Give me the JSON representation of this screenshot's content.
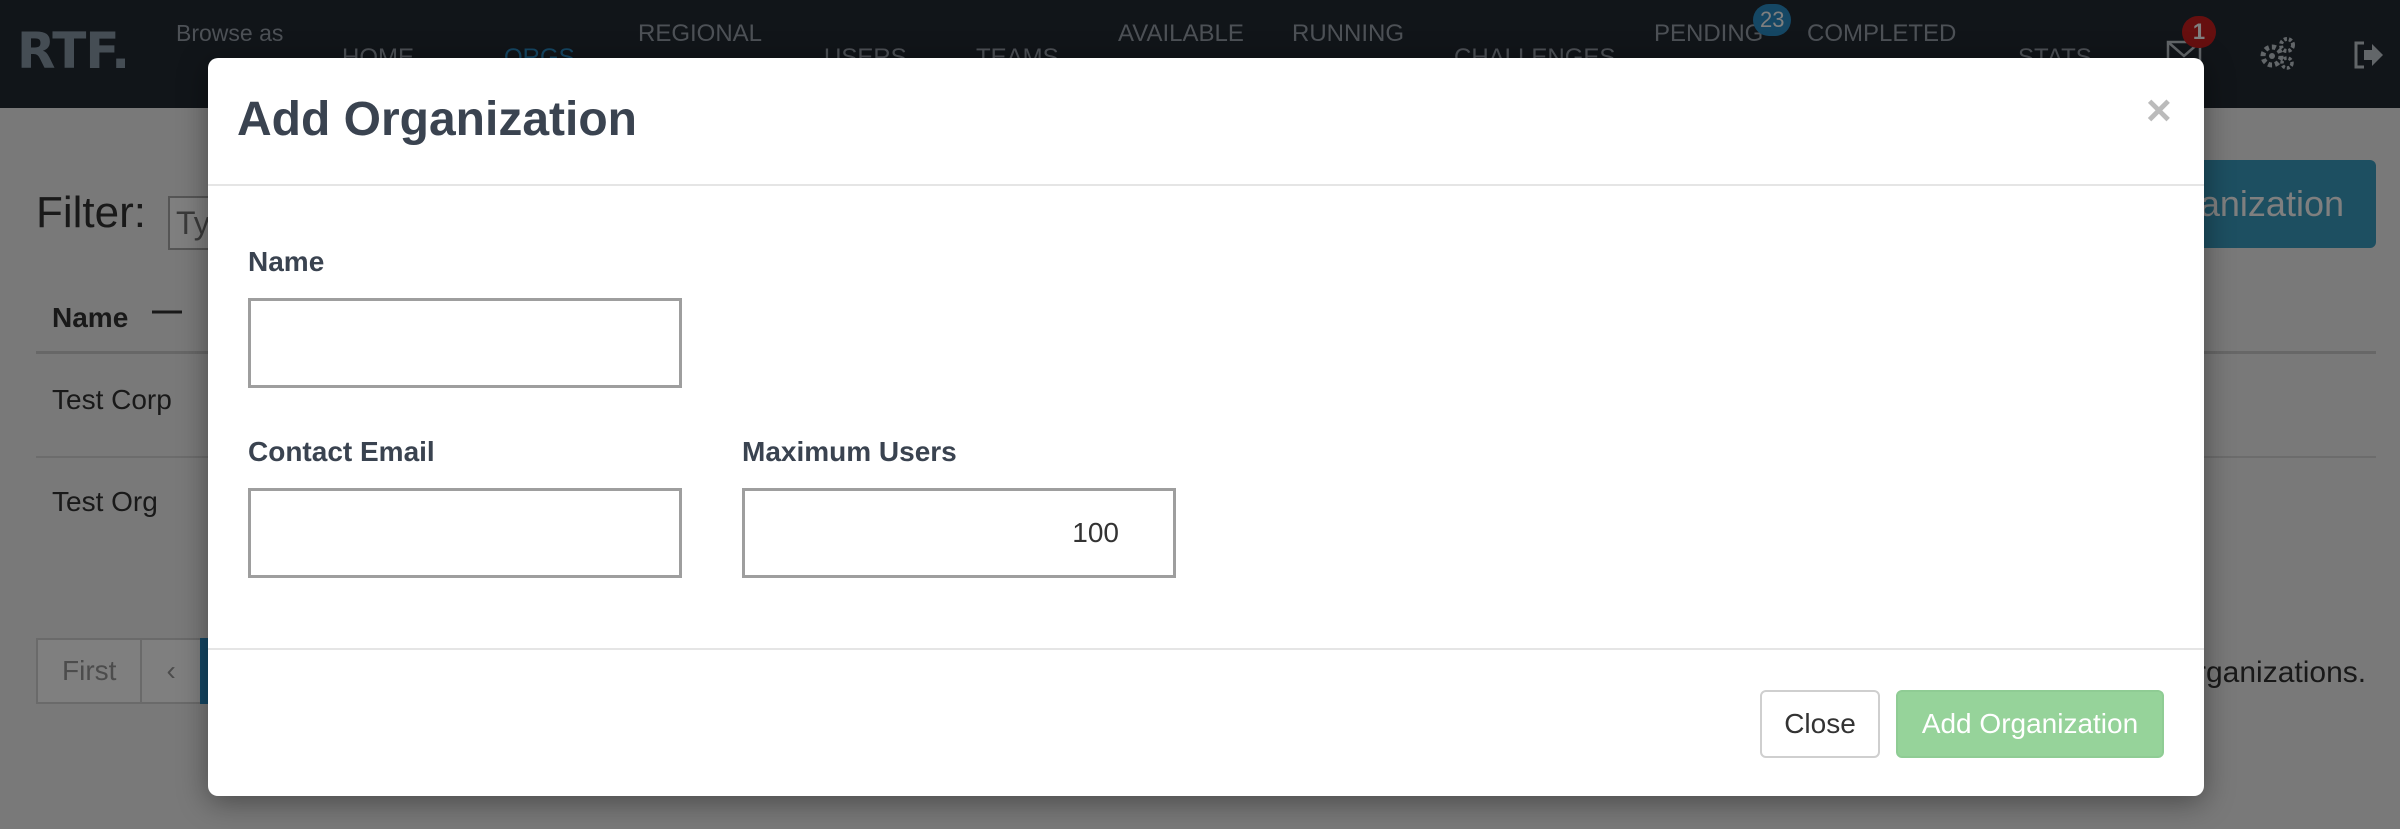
{
  "navbar": {
    "brand": "RTF.",
    "browse_as": "Browse as",
    "items": {
      "home": "HOME",
      "orgs": "ORGS",
      "regional": "REGIONAL",
      "users": "USERS",
      "teams": "TEAMS",
      "available": "AVAILABLE",
      "running": "RUNNING",
      "challenges": "CHALLENGES",
      "pending": "PENDING",
      "completed": "COMPLETED",
      "stats": "STATS"
    },
    "pending_count": "23",
    "mail_count": "1",
    "icons": [
      "mail-icon",
      "gear-icon",
      "logout-icon"
    ]
  },
  "page": {
    "filter_label": "Filter:",
    "filter_placeholder": "Typ",
    "add_button_partial": "anization",
    "table": {
      "header_name": "Name",
      "rows": [
        {
          "name": "Test Corp"
        },
        {
          "name": "Test Org"
        }
      ]
    },
    "pagination": {
      "first": "First",
      "prev": "‹"
    },
    "count_text_partial": "rganizations."
  },
  "modal": {
    "title": "Add Organization",
    "close_symbol": "×",
    "fields": {
      "name_label": "Name",
      "name_value": "",
      "email_label": "Contact Email",
      "email_value": "",
      "max_users_label": "Maximum Users",
      "max_users_value": "100"
    },
    "close_button": "Close",
    "submit_button": "Add Organization"
  },
  "colors": {
    "navbar_bg": "#232a33",
    "accent": "#2a8fc8",
    "badge_red": "#cc1f1f",
    "submit_green": "#96d39a"
  }
}
